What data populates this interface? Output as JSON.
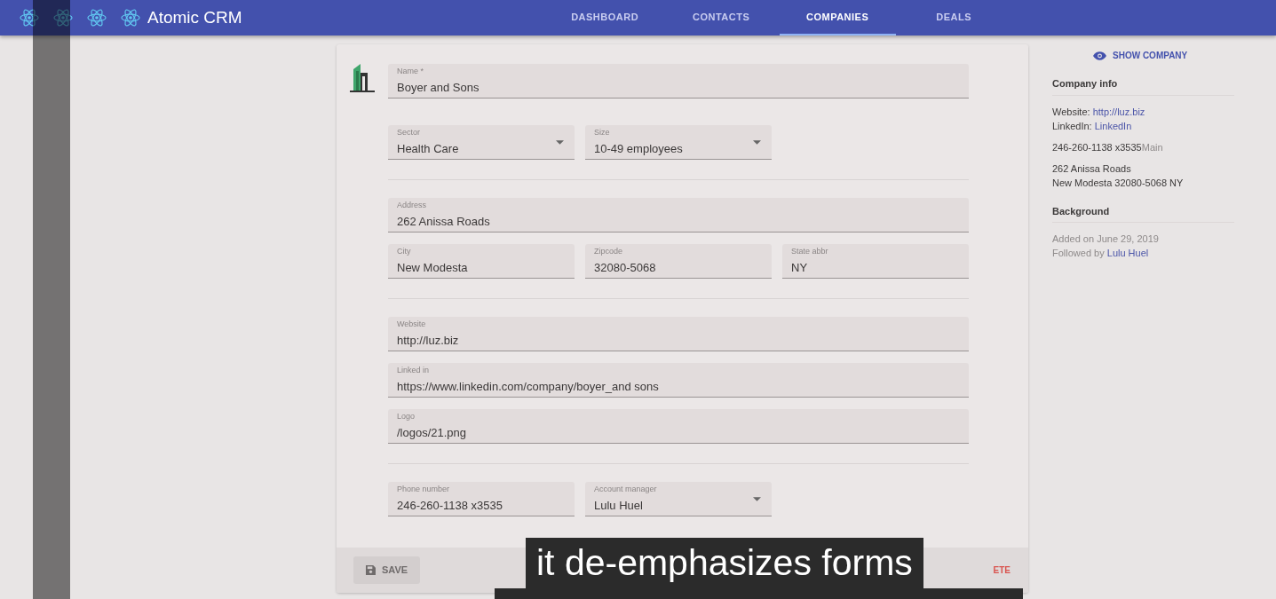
{
  "app": {
    "title": "Atomic CRM"
  },
  "tabs": [
    {
      "label": "DASHBOARD",
      "selected": false
    },
    {
      "label": "CONTACTS",
      "selected": false
    },
    {
      "label": "COMPANIES",
      "selected": true
    },
    {
      "label": "DEALS",
      "selected": false
    }
  ],
  "form": {
    "sections": [
      [
        [
          {
            "label": "Name *",
            "value": "Boyer and Sons",
            "kind": "text"
          }
        ],
        [
          {
            "label": "Sector",
            "value": "Health Care",
            "kind": "select"
          },
          {
            "label": "Size",
            "value": "10-49 employees",
            "kind": "select"
          }
        ]
      ],
      [
        [
          {
            "label": "Address",
            "value": "262 Anissa Roads",
            "kind": "text"
          }
        ],
        [
          {
            "label": "City",
            "value": "New Modesta",
            "kind": "text"
          },
          {
            "label": "Zipcode",
            "value": "32080-5068",
            "kind": "text"
          },
          {
            "label": "State abbr",
            "value": "NY",
            "kind": "text"
          }
        ]
      ],
      [
        [
          {
            "label": "Website",
            "value": "http://luz.biz",
            "kind": "text"
          }
        ],
        [
          {
            "label": "Linked in",
            "value": "https://www.linkedin.com/company/boyer_and sons",
            "kind": "text"
          }
        ],
        [
          {
            "label": "Logo",
            "value": "/logos/21.png",
            "kind": "text"
          }
        ]
      ],
      [
        [
          {
            "label": "Phone number",
            "value": "246-260-1138 x3535",
            "kind": "text"
          },
          {
            "label": "Account manager",
            "value": "Lulu Huel",
            "kind": "select"
          }
        ]
      ]
    ],
    "save": {
      "label": "SAVE",
      "disabled": true
    },
    "delete": {
      "label": "ETE"
    }
  },
  "sidebar": {
    "show_button": "SHOW COMPANY",
    "sections": [
      {
        "title": "Company info",
        "blocks": [
          [
            [
              {
                "text": "Website: ",
                "kind": "label"
              },
              {
                "text": "http://luz.biz",
                "kind": "link"
              }
            ],
            [
              {
                "text": "LinkedIn: ",
                "kind": "label"
              },
              {
                "text": "LinkedIn",
                "kind": "link"
              }
            ]
          ],
          [
            [
              {
                "text": "246-260-1138 x3535",
                "kind": "label"
              },
              {
                "text": "Main",
                "kind": "muted"
              }
            ]
          ],
          [
            [
              {
                "text": "262 Anissa Roads",
                "kind": "label"
              }
            ],
            [
              {
                "text": "New Modesta 32080-5068 NY",
                "kind": "label"
              }
            ]
          ]
        ]
      },
      {
        "title": "Background",
        "blocks": [
          [
            [
              {
                "text": "Added on June 29, 2019",
                "kind": "muted"
              }
            ],
            [
              {
                "text": "Followed by ",
                "kind": "muted"
              },
              {
                "text": "Lulu Huel",
                "kind": "link"
              }
            ]
          ]
        ]
      }
    ]
  },
  "caption": {
    "text": "it de-emphasizes forms"
  }
}
